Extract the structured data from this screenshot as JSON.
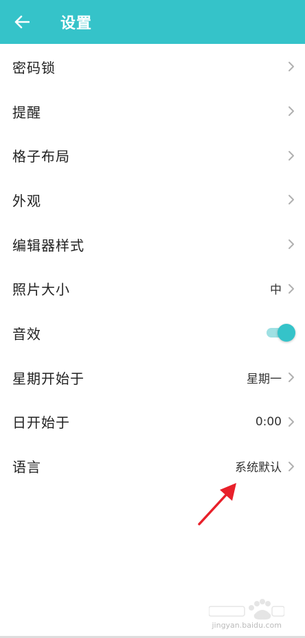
{
  "app_bar": {
    "title": "设置",
    "background_color": "#35c3c9",
    "back_icon": "arrow-left-icon"
  },
  "settings": {
    "items": [
      {
        "label": "密码锁",
        "value": "",
        "control": "chevron"
      },
      {
        "label": "提醒",
        "value": "",
        "control": "chevron"
      },
      {
        "label": "格子布局",
        "value": "",
        "control": "chevron"
      },
      {
        "label": "外观",
        "value": "",
        "control": "chevron"
      },
      {
        "label": "编辑器样式",
        "value": "",
        "control": "chevron"
      },
      {
        "label": "照片大小",
        "value": "中",
        "control": "chevron"
      },
      {
        "label": "音效",
        "value": "",
        "control": "toggle",
        "toggle_on": true
      },
      {
        "label": "星期开始于",
        "value": "星期一",
        "control": "chevron"
      },
      {
        "label": "日开始于",
        "value": "0:00",
        "control": "chevron"
      },
      {
        "label": "语言",
        "value": "系统默认",
        "control": "chevron"
      }
    ]
  },
  "annotation": {
    "type": "red-arrow",
    "color": "#e8202a"
  },
  "watermark": {
    "text": "jingyan.baidu.com"
  }
}
